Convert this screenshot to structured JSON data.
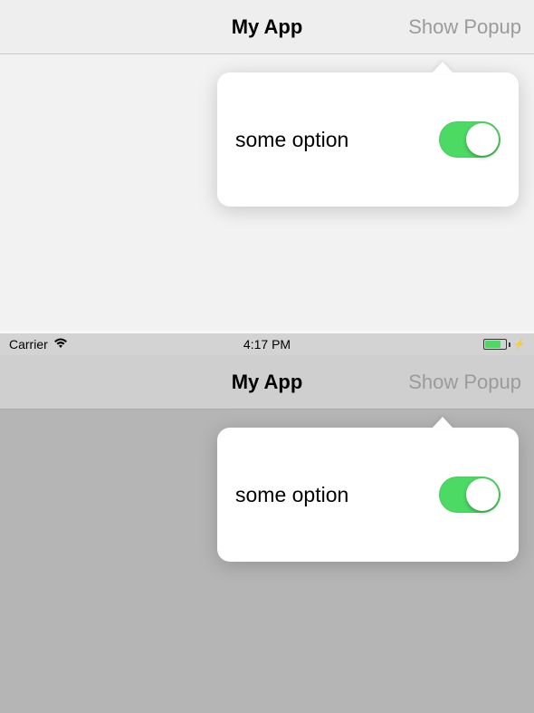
{
  "screen1": {
    "nav": {
      "title": "My App",
      "button": "Show Popup"
    },
    "popover": {
      "label": "some option",
      "switch_on": true
    }
  },
  "screen2": {
    "status": {
      "carrier": "Carrier",
      "time": "4:17 PM"
    },
    "nav": {
      "title": "My App",
      "button": "Show Popup"
    },
    "popover": {
      "label": "some option",
      "switch_on": true
    }
  },
  "colors": {
    "switch_on": "#4cd964"
  }
}
